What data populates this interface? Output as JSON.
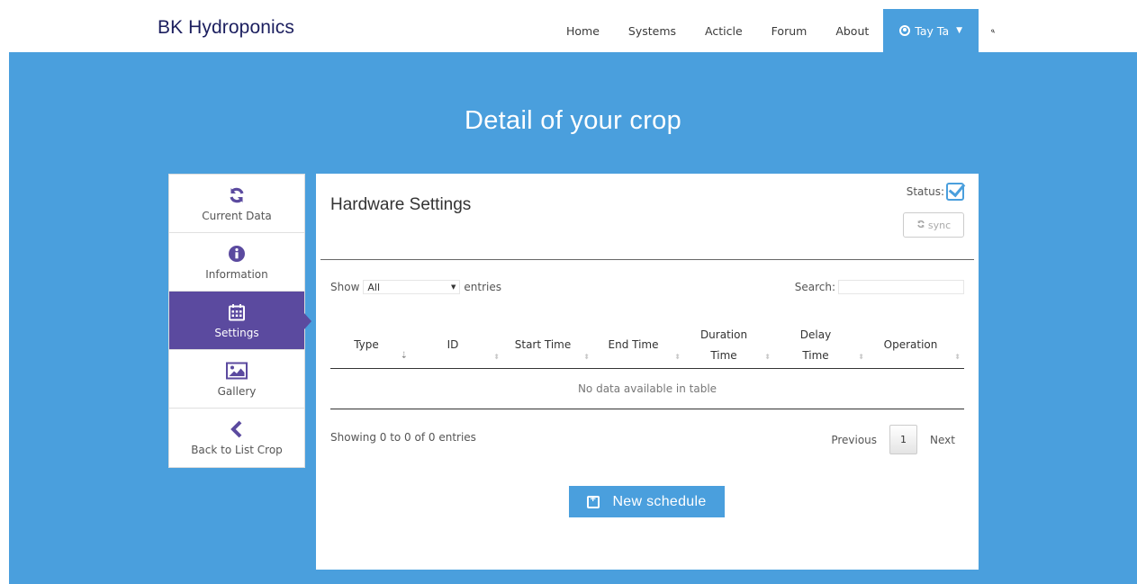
{
  "navbar": {
    "brand": "BK Hydroponics",
    "items": [
      {
        "label": "Home"
      },
      {
        "label": "Systems"
      },
      {
        "label": "Acticle"
      },
      {
        "label": "Forum"
      },
      {
        "label": "About"
      }
    ],
    "user": {
      "label": "Tay Ta",
      "icon": "user-circle-icon"
    },
    "search_icon": "search-icon"
  },
  "hero": {
    "title": "Detail of your crop",
    "background": "#4a9fdd"
  },
  "sidebar": {
    "active_color": "#5b4a9f",
    "items": [
      {
        "label": "Current Data",
        "icon": "refresh-icon"
      },
      {
        "label": "Information",
        "icon": "info-icon"
      },
      {
        "label": "Settings",
        "icon": "calendar-icon",
        "active": true
      },
      {
        "label": "Gallery",
        "icon": "image-icon"
      },
      {
        "label": "Back to List Crop",
        "icon": "chevron-left-icon"
      }
    ]
  },
  "panel": {
    "title": "Hardware Settings",
    "status_label": "Status:",
    "status_checked": true,
    "sync_label": "sync",
    "show_label": "Show",
    "show_value": "All",
    "entries_label": "entries",
    "search_label": "Search:",
    "columns": [
      {
        "label": "Type"
      },
      {
        "label": "ID"
      },
      {
        "label": "Start Time"
      },
      {
        "label": "End Time"
      },
      {
        "label": "Duration Time"
      },
      {
        "label": "Delay Time"
      },
      {
        "label": "Operation"
      }
    ],
    "empty_text": "No data available in table",
    "info_text": "Showing 0 to 0 of 0 entries",
    "pager": {
      "previous": "Previous",
      "page": "1",
      "next": "Next"
    },
    "new_schedule_label": "New schedule"
  }
}
